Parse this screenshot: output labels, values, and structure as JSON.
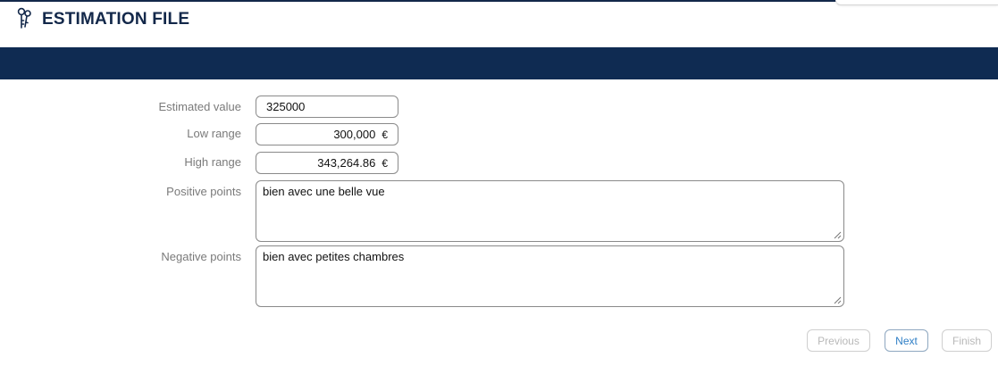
{
  "header": {
    "title": "ESTIMATION FILE",
    "icon": "keys-icon"
  },
  "form": {
    "estimated_value": {
      "label": "Estimated value",
      "value": "325000"
    },
    "low_range": {
      "label": "Low range",
      "value": "300,000",
      "currency": "€"
    },
    "high_range": {
      "label": "High range",
      "value": "343,264.86",
      "currency": "€"
    },
    "positive_points": {
      "label": "Positive points",
      "value": "bien avec une belle vue"
    },
    "negative_points": {
      "label": "Negative points",
      "value": "bien avec petites chambres"
    }
  },
  "wizard": {
    "previous_label": "Previous",
    "next_label": "Next",
    "finish_label": "Finish"
  },
  "colors": {
    "navy_band": "#0f2b52",
    "title": "#13284a",
    "active_button_text": "#2f7fc6"
  }
}
